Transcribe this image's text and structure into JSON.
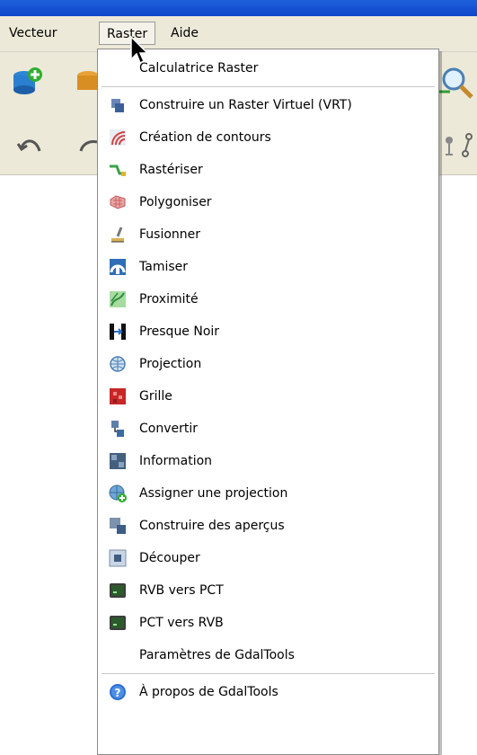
{
  "menubar": {
    "items": [
      "Vecteur",
      "Raster",
      "Aide"
    ]
  },
  "menu": {
    "items": [
      {
        "label": "Calculatrice Raster",
        "icon": "none"
      },
      {
        "label": "Construire un Raster Virtuel (VRT)",
        "icon": "vrt-icon"
      },
      {
        "label": "Création de contours",
        "icon": "contour-icon"
      },
      {
        "label": "Rastériser",
        "icon": "rasterize-icon"
      },
      {
        "label": "Polygoniser",
        "icon": "polygonize-icon"
      },
      {
        "label": "Fusionner",
        "icon": "merge-icon"
      },
      {
        "label": "Tamiser",
        "icon": "sieve-icon"
      },
      {
        "label": "Proximité",
        "icon": "proximity-icon"
      },
      {
        "label": "Presque Noir",
        "icon": "nearblack-icon"
      },
      {
        "label": "Projection",
        "icon": "projection-icon"
      },
      {
        "label": "Grille",
        "icon": "grid-icon"
      },
      {
        "label": "Convertir",
        "icon": "convert-icon"
      },
      {
        "label": "Information",
        "icon": "info-icon"
      },
      {
        "label": "Assigner une projection",
        "icon": "assign-projection-icon"
      },
      {
        "label": "Construire des aperçus",
        "icon": "overviews-icon"
      },
      {
        "label": "Découper",
        "icon": "clip-icon"
      },
      {
        "label": "RVB vers PCT",
        "icon": "rgb-to-pct-icon"
      },
      {
        "label": "PCT vers RVB",
        "icon": "pct-to-rgb-icon"
      },
      {
        "label": "Paramètres de GdalTools",
        "icon": "none"
      },
      {
        "label": "À propos de GdalTools",
        "icon": "about-icon"
      }
    ]
  }
}
